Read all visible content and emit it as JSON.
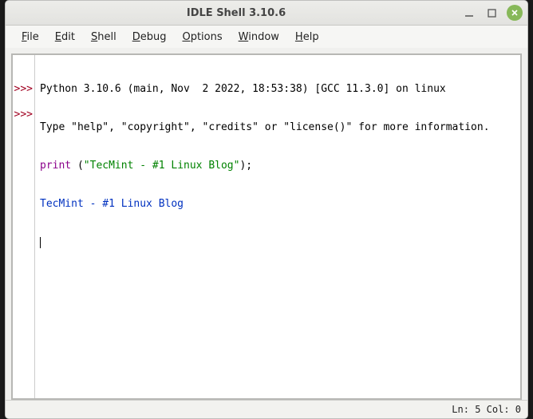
{
  "title": "IDLE Shell 3.10.6",
  "menus": {
    "file": {
      "acc": "F",
      "rest": "ile"
    },
    "edit": {
      "acc": "E",
      "rest": "dit"
    },
    "shell": {
      "acc": "S",
      "rest": "hell"
    },
    "debug": {
      "acc": "D",
      "rest": "ebug"
    },
    "options": {
      "acc": "O",
      "rest": "ptions"
    },
    "window": {
      "acc": "W",
      "rest": "indow"
    },
    "help": {
      "acc": "H",
      "rest": "elp"
    }
  },
  "shell": {
    "prompt": ">>>",
    "banner1": "Python 3.10.6 (main, Nov  2 2022, 18:53:38) [GCC 11.3.0] on linux",
    "banner2": "Type \"help\", \"copyright\", \"credits\" or \"license()\" for more information.",
    "cmd_kw": "print",
    "cmd_sp": " ",
    "cmd_lp": "(",
    "cmd_str": "\"TecMint - #1 Linux Blog\"",
    "cmd_rp": ");",
    "output": "TecMint - #1 Linux Blog"
  },
  "status": "Ln: 5  Col: 0"
}
